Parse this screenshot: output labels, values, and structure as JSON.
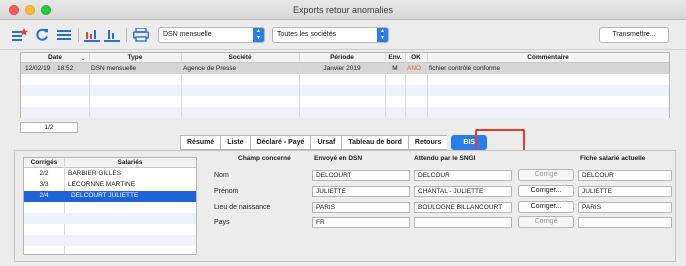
{
  "window": {
    "title": "Exports retour anomalies"
  },
  "toolbar": {
    "dsn_select": "DSN mensuelle",
    "societe_select": "Toutes les sociétés",
    "transmettre_label": "Transmettre..."
  },
  "exports_table": {
    "headers": [
      "Date",
      "Type",
      "Société",
      "Période",
      "Env.",
      "OK",
      "Commentaire"
    ],
    "row": {
      "date": "12/02/19",
      "time": "18:52",
      "type": "DSN mensuelle",
      "societe": "Agence de Presse",
      "periode": "Janvier 2019",
      "env": "M",
      "ok": "ANO",
      "commentaire": "fichier contrôlé conforme"
    }
  },
  "pager": "1/2",
  "tabs": [
    "Résumé",
    "Liste",
    "Déclaré - Payé",
    "Ursaf",
    "Tableau de bord",
    "Retours",
    "BIS"
  ],
  "salaries": {
    "headers": [
      "Corrigés",
      "Salariés"
    ],
    "rows": [
      {
        "corriges": "2/2",
        "nom": "BARBIER GILLES"
      },
      {
        "corriges": "3/3",
        "nom": "LECORNNE MARTINE"
      },
      {
        "corriges": "2/4",
        "nom": "DELCOURT JULIETTE"
      }
    ]
  },
  "details": {
    "headers": [
      "Champ concerné",
      "Envoyé en DSN",
      "Attendu par le SNGI",
      "Fiche salarié actuelle"
    ],
    "rows": [
      {
        "champ": "Nom",
        "envoye": "DELCOURT",
        "attendu": "DELCOUR",
        "button": "Corrigé",
        "fiche": "DELCOUR"
      },
      {
        "champ": "Prénom",
        "envoye": "JULIETTE",
        "attendu": "CHANTAL - JULIETTE",
        "button": "Corriger...",
        "fiche": "JULIETTE"
      },
      {
        "champ": "Lieu de naissance",
        "envoye": "PARIS",
        "attendu": "BOULOGNE BILLANCOURT",
        "button": "Corriger...",
        "fiche": "PARIS"
      },
      {
        "champ": "Pays",
        "envoye": "FR",
        "attendu": "",
        "button": "Corrigé",
        "fiche": ""
      }
    ]
  }
}
